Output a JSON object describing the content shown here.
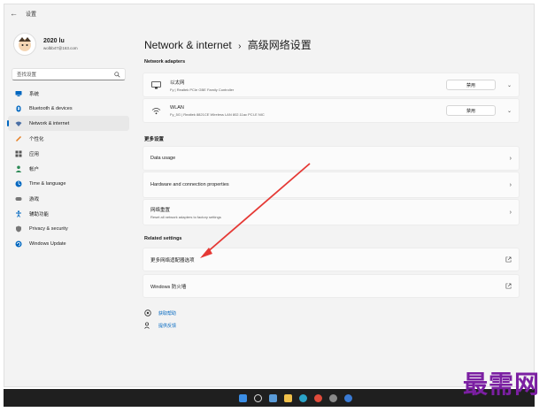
{
  "window": {
    "title": "设置"
  },
  "profile": {
    "name": "2020 lu",
    "email": "wolbb47@163.com"
  },
  "search": {
    "placeholder": "查找设置"
  },
  "sidebar": {
    "items": [
      {
        "label": "系统",
        "icon": "monitor-icon",
        "color": "#0067c0"
      },
      {
        "label": "Bluetooth & devices",
        "icon": "bluetooth-icon",
        "color": "#0067c0"
      },
      {
        "label": "Network & internet",
        "icon": "wifi-icon",
        "color": "#4a6fa5",
        "active": true
      },
      {
        "label": "个性化",
        "icon": "brush-icon",
        "color": "#e67e22"
      },
      {
        "label": "应用",
        "icon": "apps-icon",
        "color": "#555555"
      },
      {
        "label": "帐户",
        "icon": "person-icon",
        "color": "#2e8b57"
      },
      {
        "label": "Time & language",
        "icon": "globe-icon",
        "color": "#0067c0"
      },
      {
        "label": "游戏",
        "icon": "gamepad-icon",
        "color": "#777777"
      },
      {
        "label": "辅助功能",
        "icon": "accessibility-icon",
        "color": "#0067c0"
      },
      {
        "label": "Privacy & security",
        "icon": "shield-icon",
        "color": "#777777"
      },
      {
        "label": "Windows Update",
        "icon": "update-icon",
        "color": "#0067c0"
      }
    ]
  },
  "main": {
    "breadcrumb_parent": "Network & internet",
    "breadcrumb_sep": "›",
    "breadcrumb_current": "高级网络设置",
    "network_adapters_label": "Network adapters",
    "adapters": [
      {
        "name": "以太网",
        "desc": "Fy | Realtek PCIe GBE Family Controller",
        "button": "禁用"
      },
      {
        "name": "WLAN",
        "desc": "Fy_5G | Realtek 8821CE Wireless LAN 802.11ac PCI-E NIC",
        "button": "禁用"
      }
    ],
    "more_settings_label": "更多设置",
    "more_settings": [
      {
        "title": "Data usage",
        "sub": ""
      },
      {
        "title": "Hardware and connection properties",
        "sub": ""
      },
      {
        "title": "网络重置",
        "sub": "Reset all network adapters to factory settings"
      }
    ],
    "related_label": "Related settings",
    "related": [
      {
        "title": "更多网络适配器选项"
      },
      {
        "title": "Windows 防火墙"
      }
    ],
    "help": {
      "get_help": "获取帮助",
      "feedback": "提供反馈"
    }
  },
  "watermark": "最需网",
  "colors": {
    "accent": "#0067c0",
    "annotation_arrow": "#e53935",
    "watermark": "#7b1fa2",
    "taskbar": "#1f1f1f"
  }
}
